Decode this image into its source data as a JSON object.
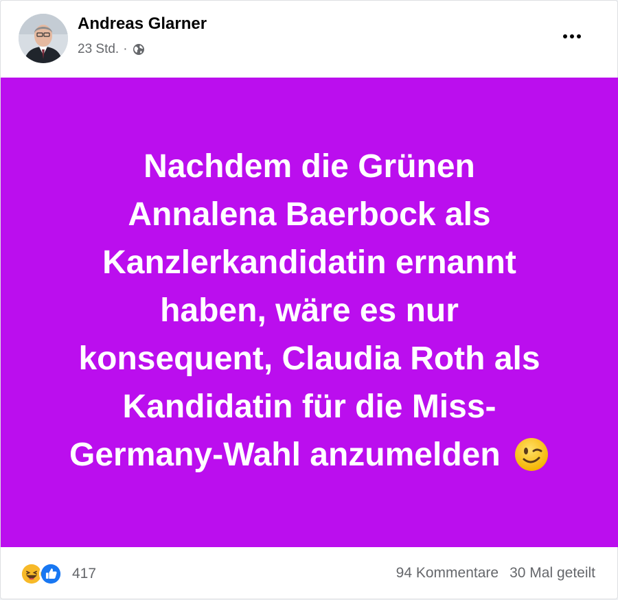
{
  "post": {
    "author": "Andreas Glarner",
    "time": "23 Std.",
    "separator": "·",
    "privacy_icon": "globe-icon",
    "more_icon": "more-options-icon",
    "background_color": "#bb0eee",
    "text_lines": [
      "Nachdem die Grünen",
      "Annalena Baerbock als",
      "Kanzlerkandidatin ernannt",
      "haben, wäre es nur",
      "konsequent, Claudia Roth als",
      "Kandidatin für die Miss-",
      "Germany-Wahl anzumelden"
    ],
    "emoji": "wink-emoji-icon"
  },
  "engagement": {
    "reaction_icons": [
      "haha-reaction-icon",
      "like-reaction-icon"
    ],
    "reaction_count": "417",
    "comments": "94 Kommentare",
    "shares": "30 Mal geteilt"
  }
}
